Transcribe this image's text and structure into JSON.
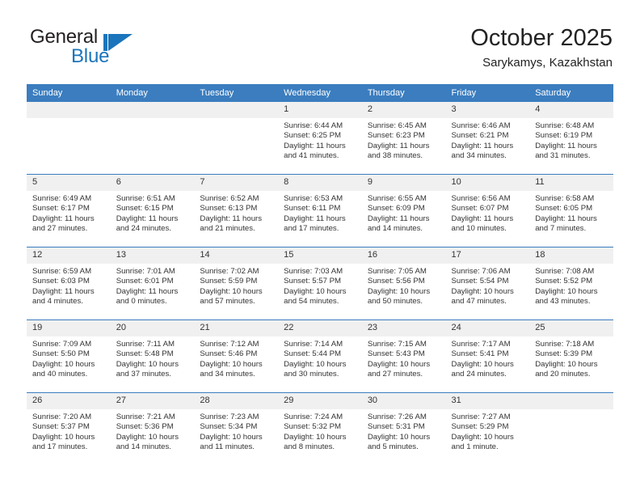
{
  "brand": {
    "name_part1": "General",
    "name_part2": "Blue",
    "accent_color": "#1b75bc"
  },
  "header": {
    "month_title": "October 2025",
    "location": "Sarykamys, Kazakhstan",
    "header_bg_color": "#3b7dbf",
    "daynum_bg_color": "#f0f0f0"
  },
  "weekday_headers": [
    "Sunday",
    "Monday",
    "Tuesday",
    "Wednesday",
    "Thursday",
    "Friday",
    "Saturday"
  ],
  "weeks": [
    [
      {
        "day": "",
        "empty": true,
        "sunrise": "",
        "sunset": "",
        "daylight_line1": "",
        "daylight_line2": ""
      },
      {
        "day": "",
        "empty": true,
        "sunrise": "",
        "sunset": "",
        "daylight_line1": "",
        "daylight_line2": ""
      },
      {
        "day": "",
        "empty": true,
        "sunrise": "",
        "sunset": "",
        "daylight_line1": "",
        "daylight_line2": ""
      },
      {
        "day": "1",
        "empty": false,
        "sunrise": "Sunrise: 6:44 AM",
        "sunset": "Sunset: 6:25 PM",
        "daylight_line1": "Daylight: 11 hours",
        "daylight_line2": "and 41 minutes."
      },
      {
        "day": "2",
        "empty": false,
        "sunrise": "Sunrise: 6:45 AM",
        "sunset": "Sunset: 6:23 PM",
        "daylight_line1": "Daylight: 11 hours",
        "daylight_line2": "and 38 minutes."
      },
      {
        "day": "3",
        "empty": false,
        "sunrise": "Sunrise: 6:46 AM",
        "sunset": "Sunset: 6:21 PM",
        "daylight_line1": "Daylight: 11 hours",
        "daylight_line2": "and 34 minutes."
      },
      {
        "day": "4",
        "empty": false,
        "sunrise": "Sunrise: 6:48 AM",
        "sunset": "Sunset: 6:19 PM",
        "daylight_line1": "Daylight: 11 hours",
        "daylight_line2": "and 31 minutes."
      }
    ],
    [
      {
        "day": "5",
        "empty": false,
        "sunrise": "Sunrise: 6:49 AM",
        "sunset": "Sunset: 6:17 PM",
        "daylight_line1": "Daylight: 11 hours",
        "daylight_line2": "and 27 minutes."
      },
      {
        "day": "6",
        "empty": false,
        "sunrise": "Sunrise: 6:51 AM",
        "sunset": "Sunset: 6:15 PM",
        "daylight_line1": "Daylight: 11 hours",
        "daylight_line2": "and 24 minutes."
      },
      {
        "day": "7",
        "empty": false,
        "sunrise": "Sunrise: 6:52 AM",
        "sunset": "Sunset: 6:13 PM",
        "daylight_line1": "Daylight: 11 hours",
        "daylight_line2": "and 21 minutes."
      },
      {
        "day": "8",
        "empty": false,
        "sunrise": "Sunrise: 6:53 AM",
        "sunset": "Sunset: 6:11 PM",
        "daylight_line1": "Daylight: 11 hours",
        "daylight_line2": "and 17 minutes."
      },
      {
        "day": "9",
        "empty": false,
        "sunrise": "Sunrise: 6:55 AM",
        "sunset": "Sunset: 6:09 PM",
        "daylight_line1": "Daylight: 11 hours",
        "daylight_line2": "and 14 minutes."
      },
      {
        "day": "10",
        "empty": false,
        "sunrise": "Sunrise: 6:56 AM",
        "sunset": "Sunset: 6:07 PM",
        "daylight_line1": "Daylight: 11 hours",
        "daylight_line2": "and 10 minutes."
      },
      {
        "day": "11",
        "empty": false,
        "sunrise": "Sunrise: 6:58 AM",
        "sunset": "Sunset: 6:05 PM",
        "daylight_line1": "Daylight: 11 hours",
        "daylight_line2": "and 7 minutes."
      }
    ],
    [
      {
        "day": "12",
        "empty": false,
        "sunrise": "Sunrise: 6:59 AM",
        "sunset": "Sunset: 6:03 PM",
        "daylight_line1": "Daylight: 11 hours",
        "daylight_line2": "and 4 minutes."
      },
      {
        "day": "13",
        "empty": false,
        "sunrise": "Sunrise: 7:01 AM",
        "sunset": "Sunset: 6:01 PM",
        "daylight_line1": "Daylight: 11 hours",
        "daylight_line2": "and 0 minutes."
      },
      {
        "day": "14",
        "empty": false,
        "sunrise": "Sunrise: 7:02 AM",
        "sunset": "Sunset: 5:59 PM",
        "daylight_line1": "Daylight: 10 hours",
        "daylight_line2": "and 57 minutes."
      },
      {
        "day": "15",
        "empty": false,
        "sunrise": "Sunrise: 7:03 AM",
        "sunset": "Sunset: 5:57 PM",
        "daylight_line1": "Daylight: 10 hours",
        "daylight_line2": "and 54 minutes."
      },
      {
        "day": "16",
        "empty": false,
        "sunrise": "Sunrise: 7:05 AM",
        "sunset": "Sunset: 5:56 PM",
        "daylight_line1": "Daylight: 10 hours",
        "daylight_line2": "and 50 minutes."
      },
      {
        "day": "17",
        "empty": false,
        "sunrise": "Sunrise: 7:06 AM",
        "sunset": "Sunset: 5:54 PM",
        "daylight_line1": "Daylight: 10 hours",
        "daylight_line2": "and 47 minutes."
      },
      {
        "day": "18",
        "empty": false,
        "sunrise": "Sunrise: 7:08 AM",
        "sunset": "Sunset: 5:52 PM",
        "daylight_line1": "Daylight: 10 hours",
        "daylight_line2": "and 43 minutes."
      }
    ],
    [
      {
        "day": "19",
        "empty": false,
        "sunrise": "Sunrise: 7:09 AM",
        "sunset": "Sunset: 5:50 PM",
        "daylight_line1": "Daylight: 10 hours",
        "daylight_line2": "and 40 minutes."
      },
      {
        "day": "20",
        "empty": false,
        "sunrise": "Sunrise: 7:11 AM",
        "sunset": "Sunset: 5:48 PM",
        "daylight_line1": "Daylight: 10 hours",
        "daylight_line2": "and 37 minutes."
      },
      {
        "day": "21",
        "empty": false,
        "sunrise": "Sunrise: 7:12 AM",
        "sunset": "Sunset: 5:46 PM",
        "daylight_line1": "Daylight: 10 hours",
        "daylight_line2": "and 34 minutes."
      },
      {
        "day": "22",
        "empty": false,
        "sunrise": "Sunrise: 7:14 AM",
        "sunset": "Sunset: 5:44 PM",
        "daylight_line1": "Daylight: 10 hours",
        "daylight_line2": "and 30 minutes."
      },
      {
        "day": "23",
        "empty": false,
        "sunrise": "Sunrise: 7:15 AM",
        "sunset": "Sunset: 5:43 PM",
        "daylight_line1": "Daylight: 10 hours",
        "daylight_line2": "and 27 minutes."
      },
      {
        "day": "24",
        "empty": false,
        "sunrise": "Sunrise: 7:17 AM",
        "sunset": "Sunset: 5:41 PM",
        "daylight_line1": "Daylight: 10 hours",
        "daylight_line2": "and 24 minutes."
      },
      {
        "day": "25",
        "empty": false,
        "sunrise": "Sunrise: 7:18 AM",
        "sunset": "Sunset: 5:39 PM",
        "daylight_line1": "Daylight: 10 hours",
        "daylight_line2": "and 20 minutes."
      }
    ],
    [
      {
        "day": "26",
        "empty": false,
        "sunrise": "Sunrise: 7:20 AM",
        "sunset": "Sunset: 5:37 PM",
        "daylight_line1": "Daylight: 10 hours",
        "daylight_line2": "and 17 minutes."
      },
      {
        "day": "27",
        "empty": false,
        "sunrise": "Sunrise: 7:21 AM",
        "sunset": "Sunset: 5:36 PM",
        "daylight_line1": "Daylight: 10 hours",
        "daylight_line2": "and 14 minutes."
      },
      {
        "day": "28",
        "empty": false,
        "sunrise": "Sunrise: 7:23 AM",
        "sunset": "Sunset: 5:34 PM",
        "daylight_line1": "Daylight: 10 hours",
        "daylight_line2": "and 11 minutes."
      },
      {
        "day": "29",
        "empty": false,
        "sunrise": "Sunrise: 7:24 AM",
        "sunset": "Sunset: 5:32 PM",
        "daylight_line1": "Daylight: 10 hours",
        "daylight_line2": "and 8 minutes."
      },
      {
        "day": "30",
        "empty": false,
        "sunrise": "Sunrise: 7:26 AM",
        "sunset": "Sunset: 5:31 PM",
        "daylight_line1": "Daylight: 10 hours",
        "daylight_line2": "and 5 minutes."
      },
      {
        "day": "31",
        "empty": false,
        "sunrise": "Sunrise: 7:27 AM",
        "sunset": "Sunset: 5:29 PM",
        "daylight_line1": "Daylight: 10 hours",
        "daylight_line2": "and 1 minute."
      },
      {
        "day": "",
        "empty": true,
        "sunrise": "",
        "sunset": "",
        "daylight_line1": "",
        "daylight_line2": ""
      }
    ]
  ]
}
